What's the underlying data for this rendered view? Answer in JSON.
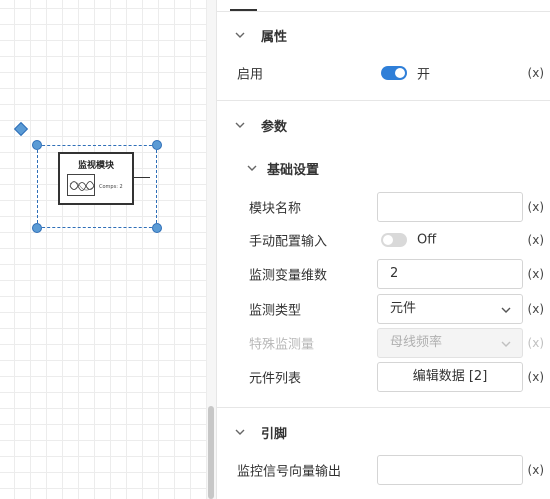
{
  "canvas": {
    "block": {
      "title": "监视模块",
      "subtitle": "Comps: 2"
    }
  },
  "panel": {
    "properties": {
      "title": "属性",
      "enable_label": "启用",
      "enable_state_text": "开",
      "expr_label": "(x)"
    },
    "params": {
      "title": "参数",
      "basic": {
        "title": "基础设置",
        "module_name": {
          "label": "模块名称",
          "value": "",
          "expr": "(x)"
        },
        "manual_input": {
          "label": "手动配置输入",
          "state_text": "Off",
          "expr": "(x)"
        },
        "dimension": {
          "label": "监测变量维数",
          "value": "2",
          "expr": "(x)"
        },
        "monitor_type": {
          "label": "监测类型",
          "value": "元件",
          "expr": "(x)"
        },
        "special": {
          "label": "特殊监测量",
          "value": "母线频率",
          "expr": "(x)"
        },
        "component_list": {
          "label": "元件列表",
          "button": "编辑数据 [2]",
          "expr": "(x)"
        }
      }
    },
    "pins": {
      "title": "引脚",
      "signal_output": {
        "label": "监控信号向量输出",
        "value": "",
        "expr": "(x)"
      }
    }
  },
  "colors": {
    "accent": "#2f7fd8",
    "selection": "#2f6fb8"
  }
}
